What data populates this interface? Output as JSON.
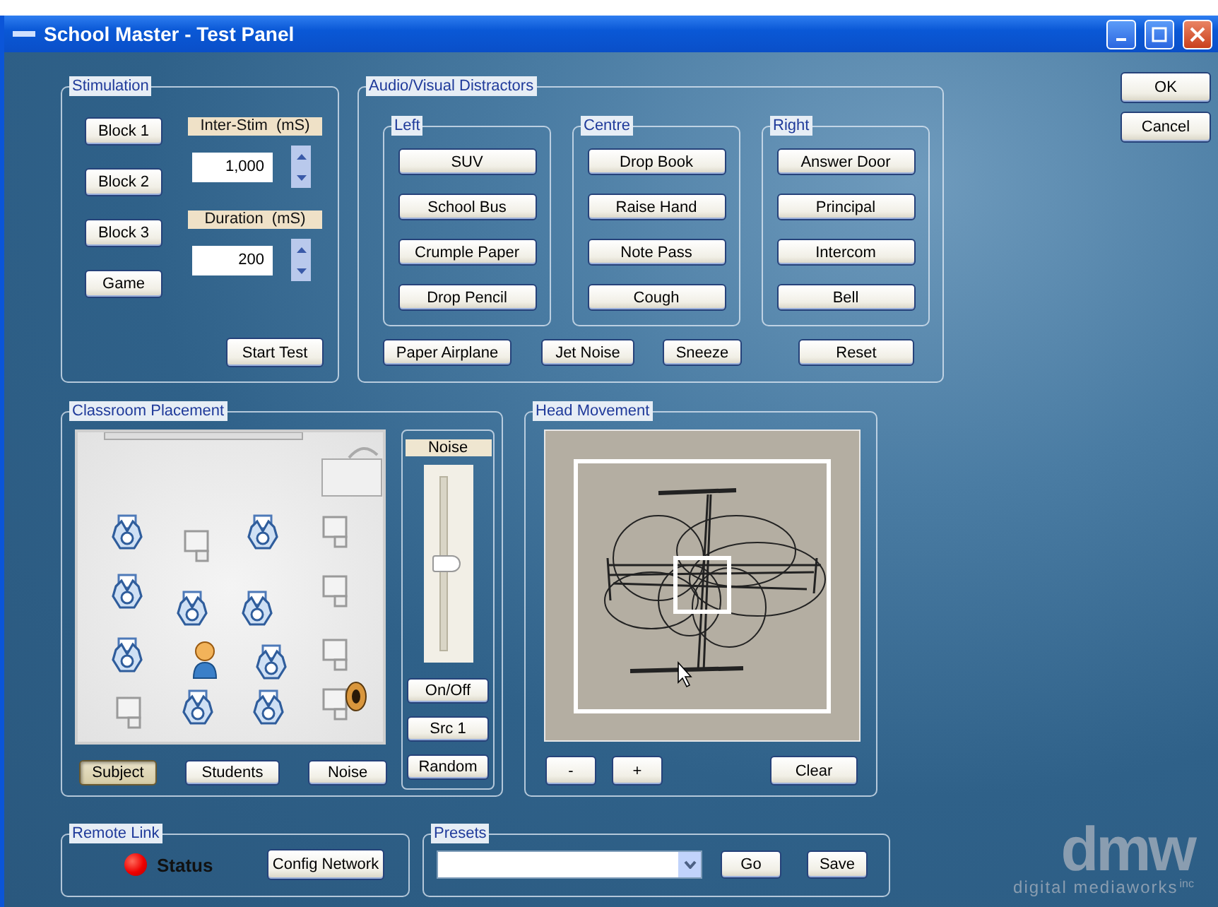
{
  "window": {
    "title": "School Master - Test Panel"
  },
  "stimulation": {
    "title": "Stimulation",
    "blocks": [
      "Block 1",
      "Block 2",
      "Block 3",
      "Game"
    ],
    "inter_stim": {
      "label": "Inter-Stim  (mS)",
      "value": "1,000"
    },
    "duration": {
      "label": "Duration  (mS)",
      "value": "200"
    },
    "start_button": "Start Test"
  },
  "distractors": {
    "title": "Audio/Visual Distractors",
    "groups": [
      {
        "title": "Left",
        "buttons": [
          "SUV",
          "School Bus",
          "Crumple Paper",
          "Drop Pencil"
        ]
      },
      {
        "title": "Centre",
        "buttons": [
          "Drop Book",
          "Raise Hand",
          "Note Pass",
          "Cough"
        ]
      },
      {
        "title": "Right",
        "buttons": [
          "Answer Door",
          "Principal",
          "Intercom",
          "Bell"
        ]
      }
    ],
    "extra_buttons": [
      "Paper Airplane",
      "Jet Noise",
      "Sneeze"
    ],
    "reset_button": "Reset"
  },
  "dialog_buttons": [
    "OK",
    "Cancel"
  ],
  "classroom": {
    "title": "Classroom Placement",
    "placement_buttons": [
      {
        "label": "Subject",
        "selected": true
      },
      {
        "label": "Students",
        "selected": false
      },
      {
        "label": "Noise",
        "selected": false
      }
    ],
    "noise_panel": {
      "label": "Noise",
      "slider": {
        "level": 0.5
      },
      "buttons": [
        "On/Off",
        "Src 1",
        "Random"
      ]
    }
  },
  "head_movement": {
    "title": "Head Movement",
    "zoom_buttons": [
      "-",
      "+"
    ],
    "clear_button": "Clear"
  },
  "remote_link": {
    "title": "Remote Link",
    "status": {
      "label": "Status",
      "connected": false
    },
    "config_button": "Config Network"
  },
  "presets": {
    "title": "Presets",
    "go_button": "Go",
    "save_button": "Save"
  },
  "logo": {
    "mark": "dmw",
    "tagline": "digital mediaworks",
    "suffix": "inc"
  }
}
